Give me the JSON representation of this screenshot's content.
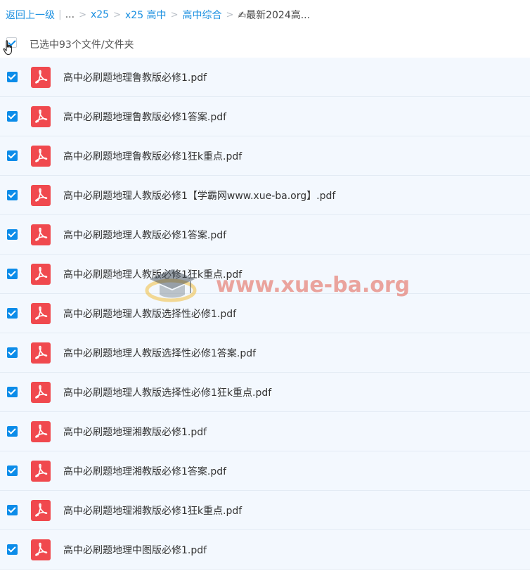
{
  "breadcrumb": {
    "back_label": "返回上一级",
    "pipe": "|",
    "ellipsis": "...",
    "sep": ">",
    "items": [
      "x25",
      "x25 高中",
      "高中综合"
    ],
    "current": "✍最新2024高..."
  },
  "selection": {
    "text": "已选中93个文件/文件夹",
    "checked": true
  },
  "files": [
    {
      "name": "高中必刷题地理鲁教版必修1.pdf",
      "checked": true
    },
    {
      "name": "高中必刷题地理鲁教版必修1答案.pdf",
      "checked": true
    },
    {
      "name": "高中必刷题地理鲁教版必修1狂k重点.pdf",
      "checked": true
    },
    {
      "name": "高中必刷题地理人教版必修1【学霸网www.xue-ba.org】.pdf",
      "checked": true
    },
    {
      "name": "高中必刷题地理人教版必修1答案.pdf",
      "checked": true
    },
    {
      "name": "高中必刷题地理人教版必修1狂k重点.pdf",
      "checked": true
    },
    {
      "name": "高中必刷题地理人教版选择性必修1.pdf",
      "checked": true
    },
    {
      "name": "高中必刷题地理人教版选择性必修1答案.pdf",
      "checked": true
    },
    {
      "name": "高中必刷题地理人教版选择性必修1狂k重点.pdf",
      "checked": true
    },
    {
      "name": "高中必刷题地理湘教版必修1.pdf",
      "checked": true
    },
    {
      "name": "高中必刷题地理湘教版必修1答案.pdf",
      "checked": true
    },
    {
      "name": "高中必刷题地理湘教版必修1狂k重点.pdf",
      "checked": true
    },
    {
      "name": "高中必刷题地理中图版必修1.pdf",
      "checked": true
    }
  ],
  "file_icon": "pdf-file-icon",
  "colors": {
    "accent": "#0c8ce9",
    "link": "#1a8fe0",
    "row_bg": "#f3f8fe",
    "pdf_red": "#f0494e"
  },
  "watermark": {
    "text": "www.xue-ba.org"
  }
}
